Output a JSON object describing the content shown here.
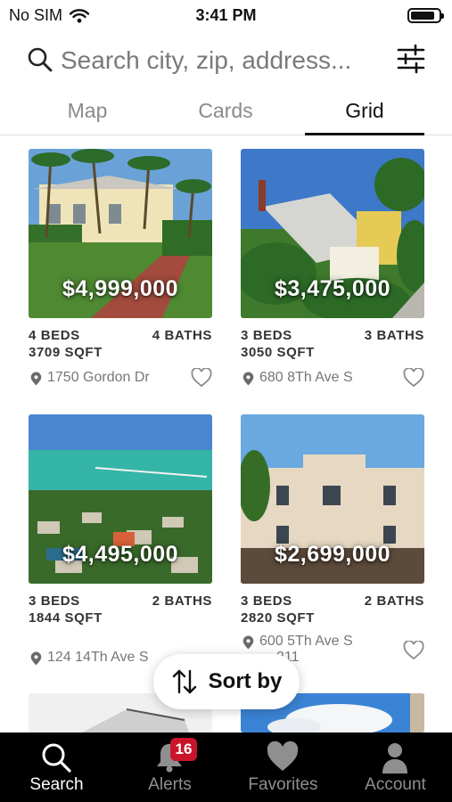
{
  "status_bar": {
    "carrier": "No SIM",
    "time": "3:41 PM",
    "battery_level": 0.85
  },
  "search": {
    "placeholder": "Search city, zip, address...",
    "icon": "search-icon",
    "filter_icon": "sliders-icon"
  },
  "tabs": [
    {
      "label": "Map",
      "active": false
    },
    {
      "label": "Cards",
      "active": false
    },
    {
      "label": "Grid",
      "active": true
    }
  ],
  "listings": [
    {
      "price": "$4,999,000",
      "beds": "4 BEDS",
      "baths": "4 BATHS",
      "sqft": "3709 SQFT",
      "address": "1750 Gordon Dr"
    },
    {
      "price": "$3,475,000",
      "beds": "3 BEDS",
      "baths": "3 BATHS",
      "sqft": "3050 SQFT",
      "address": "680 8Th Ave S"
    },
    {
      "price": "$4,495,000",
      "beds": "3 BEDS",
      "baths": "2 BATHS",
      "sqft": "1844 SQFT",
      "address": "124 14Th Ave S"
    },
    {
      "price": "$2,699,000",
      "beds": "3 BEDS",
      "baths": "2 BATHS",
      "sqft": "2820 SQFT",
      "address": "600 5Th Ave S",
      "address_line2": "211"
    }
  ],
  "sort": {
    "label": "Sort by",
    "icon": "sort-arrows-icon"
  },
  "nav": {
    "items": [
      {
        "label": "Search",
        "icon": "search-icon",
        "active": true
      },
      {
        "label": "Alerts",
        "icon": "bell-icon",
        "badge": "16"
      },
      {
        "label": "Favorites",
        "icon": "heart-icon"
      },
      {
        "label": "Account",
        "icon": "person-icon"
      }
    ]
  },
  "colors": {
    "badge": "#c9152b",
    "tab_bar": "#000000",
    "active_underline": "#111111"
  }
}
